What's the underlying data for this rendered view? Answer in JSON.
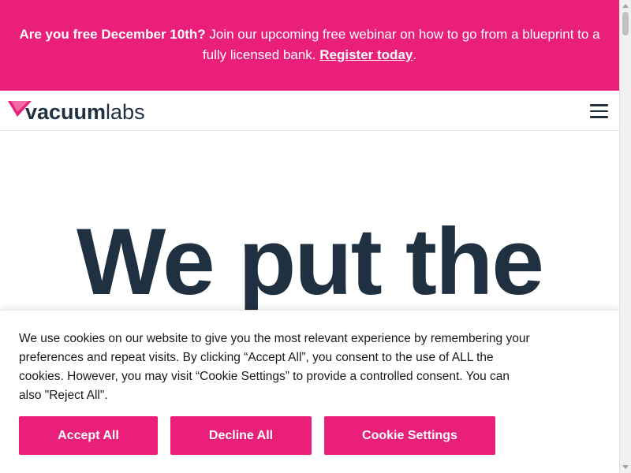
{
  "announcement": {
    "lead": "Are you free December 10th?",
    "body": " Join our upcoming free webinar on how to go from a blueprint to a fully licensed bank. ",
    "link_label": "Register today",
    "trailing": "."
  },
  "header": {
    "logo_strong": "vacuum",
    "logo_light": "labs",
    "menu_icon": "hamburger-menu-icon"
  },
  "hero": {
    "title": "We put the"
  },
  "cookie_banner": {
    "message": "We use cookies on our website to give you the most relevant experience by remembering your preferences and repeat visits. By clicking “Accept All”, you consent to the use of ALL the cookies. However, you may visit “Cookie Settings” to provide a controlled consent. You can also \"Reject All\".",
    "accept_label": "Accept All",
    "decline_label": "Decline All",
    "settings_label": "Cookie Settings"
  },
  "colors": {
    "brand_pink": "#e91f7a",
    "text_dark": "#1f3041"
  }
}
